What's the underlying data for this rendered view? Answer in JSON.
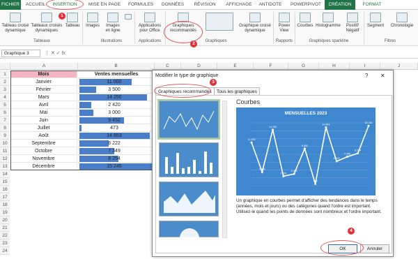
{
  "tabs": [
    "FICHIER",
    "ACCUEIL",
    "INSERTION",
    "MISE EN PAGE",
    "FORMULES",
    "DONNÉES",
    "RÉVISION",
    "AFFICHAGE",
    "ANTIDOTE",
    "POWERPIVOT",
    "CRÉATION",
    "FORMAT"
  ],
  "ribbon": {
    "tableaux_croise": "Tableau croisé dynamique",
    "tableaux_croises_reco": "Tableaux croisés dynamiques",
    "tableau": "Tableau",
    "images": "Images",
    "images_ligne": "Images en ligne",
    "applications_office": "Applications pour Office",
    "graphiques_reco": "Graphiques recommandés",
    "graphique_croise": "Graphique croisé dynamique",
    "power_view": "Power View",
    "courbes": "Courbes",
    "histogramme": "Histogramme",
    "positif_negatif": "Positif/ Négatif",
    "segment": "Segment",
    "chronologie": "Chronologie",
    "grp_tableaux": "Tableaux",
    "grp_illustrations": "Illustrations",
    "grp_applications": "Applications",
    "grp_graphiques": "Graphiques",
    "grp_rapports": "Rapports",
    "grp_sparkline": "Graphiques sparkline",
    "grp_filtres": "Filtres"
  },
  "namebox": "Graphique 3",
  "columns": [
    "A",
    "B",
    "C",
    "D",
    "E",
    "F",
    "G",
    "H",
    "I",
    "J"
  ],
  "headers": {
    "mois": "Mois",
    "ventes": "Ventes mensuelles"
  },
  "rows": [
    {
      "mois": "Janvier",
      "val": "11 000",
      "n": 11000
    },
    {
      "mois": "Février",
      "val": "3 500",
      "n": 3500
    },
    {
      "mois": "Mars",
      "val": "14 250",
      "n": 14250
    },
    {
      "mois": "Avril",
      "val": "2 420",
      "n": 2420
    },
    {
      "mois": "Mai",
      "val": "3 000",
      "n": 3000
    },
    {
      "mois": "Juin",
      "val": "9 452",
      "n": 9452
    },
    {
      "mois": "Juillet",
      "val": "473",
      "n": 473
    },
    {
      "mois": "Août",
      "val": "14 853",
      "n": 14853
    },
    {
      "mois": "Septembre",
      "val": "6 222",
      "n": 6222
    },
    {
      "mois": "Octobre",
      "val": "7 349",
      "n": 7349
    },
    {
      "mois": "Novembre",
      "val": "8 254",
      "n": 8254
    },
    {
      "mois": "Décembre",
      "val": "15 245",
      "n": 15245
    }
  ],
  "dialog": {
    "title": "Modifier le type de graphique",
    "help": "?",
    "close": "✕",
    "tab_reco": "Graphiques recommandés",
    "tab_all": "Tous les graphiques",
    "chart_name": "Courbes",
    "preview_title": "MENSUELLES 2023",
    "description": "Un graphique en courbes permet d'afficher des tendances dans le temps (années, mois et jours) ou des catégories quand l'ordre est important. Utilisez-le quand les points de données sont nombreux et l'ordre important.",
    "ok": "OK",
    "cancel": "Annuler"
  },
  "markers": [
    "1",
    "2",
    "3",
    "4"
  ],
  "colors": {
    "excel_green": "#217346",
    "bar_blue": "#4a7ec9",
    "header_pink": "#f4b6c2",
    "marker_red": "#e0303a"
  }
}
